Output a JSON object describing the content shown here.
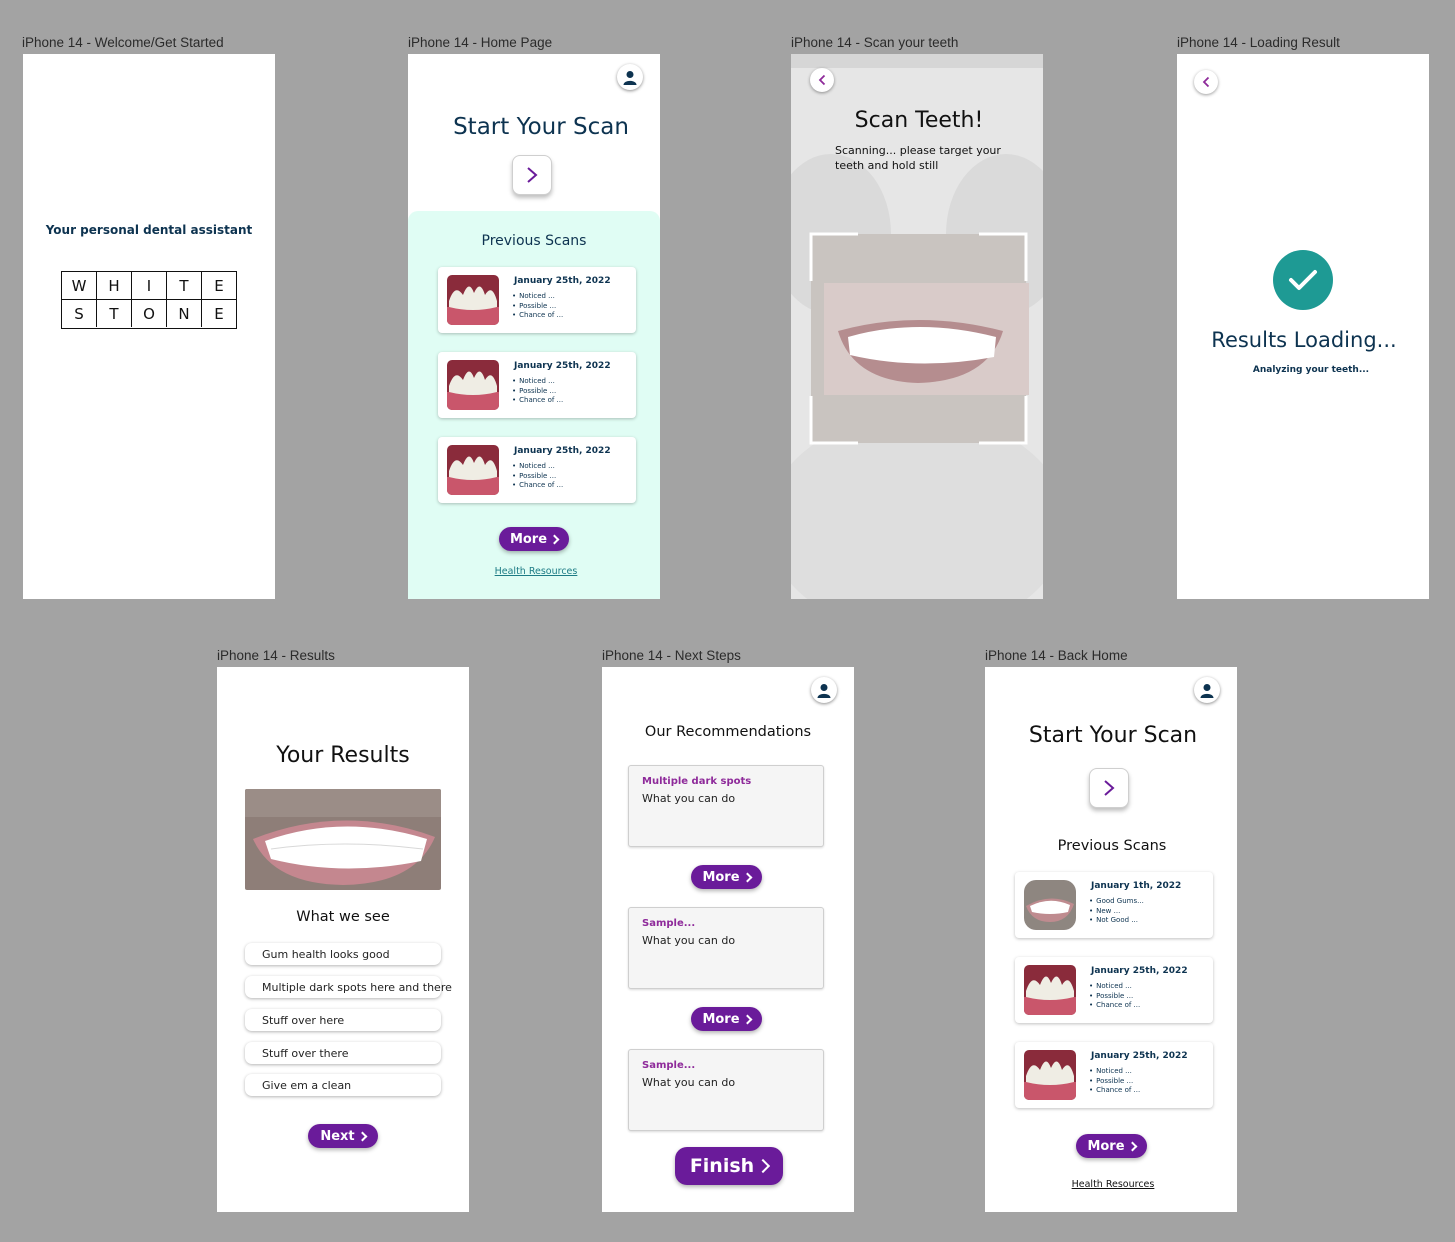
{
  "frames": {
    "welcome": {
      "label": "iPhone 14 - Welcome/Get Started",
      "tagline": "Your personal dental assistant",
      "logo_row1": [
        "W",
        "H",
        "I",
        "T",
        "E"
      ],
      "logo_row2": [
        "S",
        "T",
        "O",
        "N",
        "E"
      ]
    },
    "home": {
      "label": "iPhone 14 - Home Page",
      "title": "Start Your Scan",
      "previous_title": "Previous Scans",
      "scans": [
        {
          "date": "January 25th, 2022",
          "notes": [
            "Noticed ...",
            "Possible ...",
            "Chance of ..."
          ]
        },
        {
          "date": "January 25th, 2022",
          "notes": [
            "Noticed ...",
            "Possible ...",
            "Chance of ..."
          ]
        },
        {
          "date": "January 25th, 2022",
          "notes": [
            "Noticed ...",
            "Possible ...",
            "Chance of ..."
          ]
        }
      ],
      "more_label": "More",
      "link_label": "Health Resources"
    },
    "scan": {
      "label": "iPhone 14 - Scan your teeth",
      "title": "Scan Teeth!",
      "instructions": "Scanning... please target your teeth and hold still"
    },
    "loading": {
      "label": "iPhone 14 - Loading Result",
      "title": "Results Loading...",
      "subtitle": "Analyzing your teeth..."
    },
    "results": {
      "label": "iPhone 14 - Results",
      "title": "Your Results",
      "section": "What we see",
      "items": [
        "Gum health looks good",
        "Multiple dark spots here and there",
        "Stuff over here",
        "Stuff over there",
        "Give em a clean"
      ],
      "next_label": "Next"
    },
    "next_steps": {
      "label": "iPhone 14 - Next Steps",
      "title": "Our Recommendations",
      "recs": [
        {
          "title": "Multiple dark spots",
          "body": "What you can do"
        },
        {
          "title": "Sample...",
          "body": "What you can do"
        },
        {
          "title": "Sample...",
          "body": "What you can do"
        }
      ],
      "more_label": "More",
      "finish_label": "Finish"
    },
    "back_home": {
      "label": "iPhone 14 - Back Home",
      "title": "Start Your Scan",
      "previous_title": "Previous Scans",
      "scans": [
        {
          "date": "January 1th, 2022",
          "notes": [
            "Good Gums...",
            "New ...",
            "Not Good ..."
          ]
        },
        {
          "date": "January 25th, 2022",
          "notes": [
            "Noticed ...",
            "Possible ...",
            "Chance of ..."
          ]
        },
        {
          "date": "January 25th, 2022",
          "notes": [
            "Noticed ...",
            "Possible ...",
            "Chance of ..."
          ]
        }
      ],
      "more_label": "More",
      "link_label": "Health Resources"
    }
  },
  "colors": {
    "canvas": "#a3a3a3",
    "navy": "#0d3350",
    "purple": "#6a1b9a",
    "mint": "#e0fdf4",
    "teal_check": "#1e9a94"
  },
  "icons": [
    "user-avatar-icon",
    "chevron-right-icon",
    "chevron-left-icon",
    "check-icon"
  ]
}
